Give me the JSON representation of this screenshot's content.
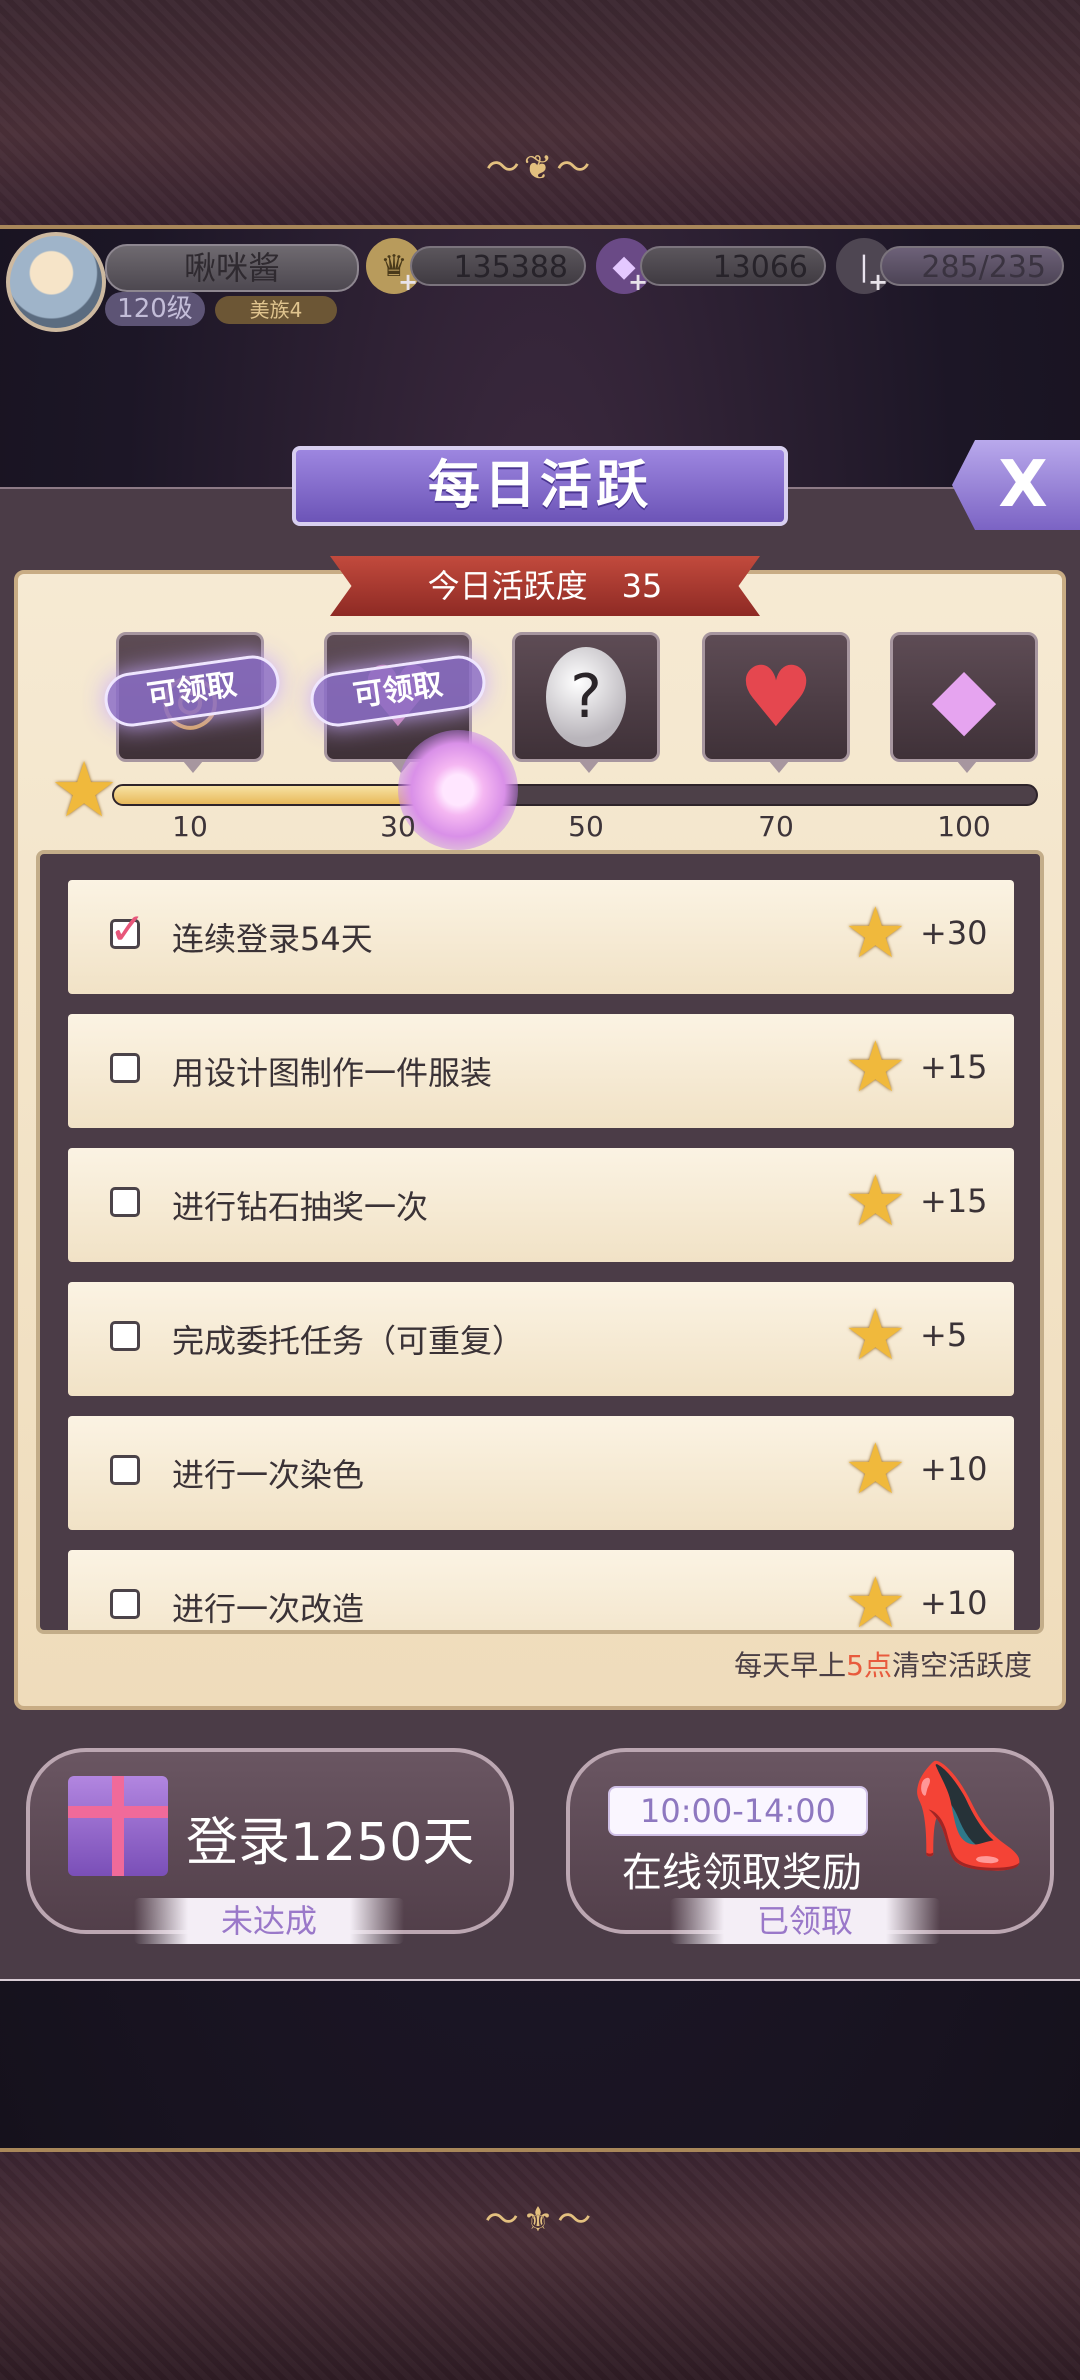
{
  "player": {
    "name": "啾咪酱",
    "level": "120级",
    "tag": "美族4"
  },
  "resources": {
    "gold": "135388",
    "diamonds": "13066",
    "stamina": "285/235"
  },
  "dialog": {
    "title": "每日活跃",
    "close_label": "X"
  },
  "activity": {
    "label": "今日活跃度",
    "value": "35",
    "progress_fraction": 0.35,
    "milestones": [
      "10",
      "30",
      "50",
      "70",
      "100"
    ],
    "claim_label": "可领取",
    "mystery_symbol": "?"
  },
  "tasks": [
    {
      "label": "连续登录54天",
      "points": "+30",
      "done": true
    },
    {
      "label": "用设计图制作一件服装",
      "points": "+15",
      "done": false
    },
    {
      "label": "进行钻石抽奖一次",
      "points": "+15",
      "done": false
    },
    {
      "label": "完成委托任务（可重复）",
      "points": "+5",
      "done": false
    },
    {
      "label": "进行一次染色",
      "points": "+10",
      "done": false
    },
    {
      "label": "进行一次改造",
      "points": "+10",
      "done": false
    }
  ],
  "reset_note": {
    "prefix": "每天早上",
    "highlight": "5点",
    "suffix": "清空活跃度"
  },
  "login_card": {
    "title": "登录1250天",
    "status": "未达成"
  },
  "online_card": {
    "time": "10:00-14:00",
    "title": "在线领取奖励",
    "status": "已领取"
  },
  "colors": {
    "accent_purple": "#7b63c4",
    "ribbon_red": "#b13b31",
    "highlight_red": "#e85a3d",
    "star_gold": "#f0b93c"
  }
}
